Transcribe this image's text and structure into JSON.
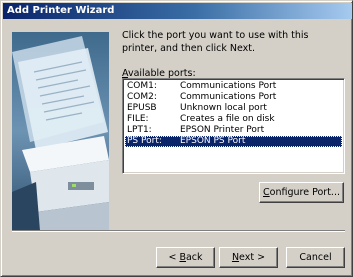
{
  "window": {
    "title": "Add Printer Wizard"
  },
  "instruction": "Click the port you want to use with this printer, and then click Next.",
  "ports_label": {
    "mnemonic": "A",
    "rest": "vailable ports:"
  },
  "ports": [
    {
      "name": "COM1:",
      "description": "Communications Port",
      "selected": false
    },
    {
      "name": "COM2:",
      "description": "Communications Port",
      "selected": false
    },
    {
      "name": "EPUSB",
      "description": "Unknown local port",
      "selected": false
    },
    {
      "name": "FILE:",
      "description": "Creates a file on disk",
      "selected": false
    },
    {
      "name": "LPT1:",
      "description": "EPSON Printer Port",
      "selected": false
    },
    {
      "name": "PS Port:",
      "description": "EPSON PS Port",
      "selected": true
    }
  ],
  "buttons": {
    "configure": {
      "mnemonic": "C",
      "rest": "onfigure Port..."
    },
    "back": {
      "prefix": "< ",
      "mnemonic": "B",
      "rest": "ack"
    },
    "next": {
      "prefix": "",
      "mnemonic": "N",
      "rest": "ext >"
    },
    "cancel": {
      "label": "Cancel"
    }
  },
  "colors": {
    "title_start": "#0a246a",
    "title_end": "#a6caf0",
    "selection": "#0a246a",
    "face": "#d4d0c8"
  }
}
